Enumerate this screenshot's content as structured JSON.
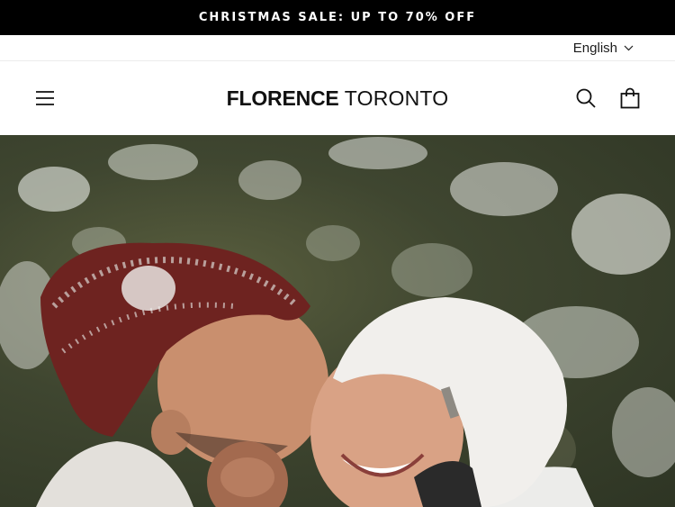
{
  "announcement": {
    "text": "CHRISTMAS SALE: UP TO 70% OFF"
  },
  "language": {
    "selected": "English"
  },
  "brand": {
    "bold": "FLORENCE",
    "light": "TORONTO"
  },
  "icons": {
    "menu": "hamburger-menu-icon",
    "search": "search-icon",
    "cart": "shopping-bag-icon"
  },
  "hero": {
    "alt": "Couple in snowy knit beanies laughing in a winter forest"
  },
  "colors": {
    "announcement_bg": "#000000",
    "announcement_text": "#ffffff",
    "text": "#111111"
  }
}
